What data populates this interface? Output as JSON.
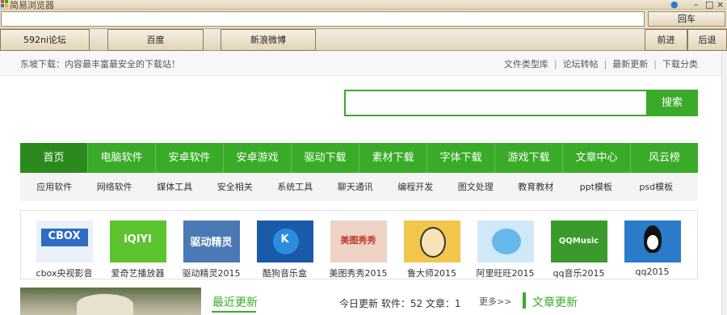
{
  "browser": {
    "title": "简易浏览器",
    "address_value": "",
    "go_label": "回车",
    "toolbar": {
      "btn1": "592ni论坛",
      "btn2": "百度",
      "btn3": "新浪微博",
      "forward": "前进",
      "back": "后退"
    }
  },
  "site": {
    "slogan": "东坡下载：内容最丰富最安全的下载站！",
    "top_links": [
      "文件类型库",
      "论坛转帖",
      "最新更新",
      "下载分类"
    ],
    "search_button": "搜索",
    "nav": [
      "首页",
      "电脑软件",
      "安卓软件",
      "安卓游戏",
      "驱动下载",
      "素材下载",
      "字体下载",
      "游戏下载",
      "文章中心",
      "风云榜"
    ],
    "subnav": [
      "应用软件",
      "网络软件",
      "媒体工具",
      "安全相关",
      "系统工具",
      "聊天通讯",
      "编程开发",
      "图文处理",
      "教育教材",
      "ppt模板",
      "psd模板"
    ],
    "apps": [
      {
        "name": "cbox央视影音",
        "thumb": "CBOX",
        "color": "#2f6cc4"
      },
      {
        "name": "爱奇艺播放器",
        "thumb": "iQIYI",
        "color": "#5cc22e"
      },
      {
        "name": "驱动精灵2015",
        "thumb": "驱动精灵",
        "color": "#4b79b5"
      },
      {
        "name": "酷狗音乐盒",
        "thumb": "K",
        "color": "#1a5aa8"
      },
      {
        "name": "美图秀秀2015",
        "thumb": "美图秀秀",
        "color": "#e08f7a"
      },
      {
        "name": "鲁大师2015",
        "thumb": "",
        "color": "#f2c64b"
      },
      {
        "name": "阿里旺旺2015",
        "thumb": "",
        "color": "#66b8e8"
      },
      {
        "name": "qq音乐2015",
        "thumb": "QQMusic",
        "color": "#3a9a2c"
      },
      {
        "name": "qq2015",
        "thumb": "",
        "color": "#2a7bc9"
      }
    ],
    "recent_title": "最近更新",
    "recent_stats": "今日更新 软件：52 文章：1",
    "more": "更多>>",
    "article_title": "文章更新"
  }
}
